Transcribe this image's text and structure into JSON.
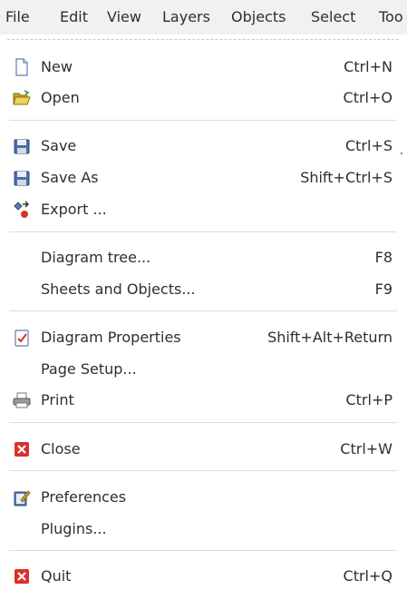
{
  "menubar": {
    "items": [
      "File",
      "Edit",
      "View",
      "Layers",
      "Objects",
      "Select",
      "Too"
    ]
  },
  "file_menu": {
    "new": {
      "label": "New",
      "accel": "Ctrl+N",
      "icon": "new-document-icon"
    },
    "open": {
      "label": "Open",
      "accel": "Ctrl+O",
      "icon": "open-folder-icon"
    },
    "save": {
      "label": "Save",
      "accel": "Ctrl+S",
      "icon": "floppy-disk-icon"
    },
    "save_as": {
      "label": "Save As",
      "accel": "Shift+Ctrl+S",
      "icon": "floppy-disk-icon"
    },
    "export": {
      "label": "Export ...",
      "accel": "",
      "icon": "export-icon"
    },
    "diagram_tree": {
      "label": "Diagram tree...",
      "accel": "F8"
    },
    "sheets_objects": {
      "label": "Sheets and Objects...",
      "accel": "F9"
    },
    "diagram_properties": {
      "label": "Diagram Properties",
      "accel": "Shift+Alt+Return",
      "icon": "properties-checkbox-icon"
    },
    "page_setup": {
      "label": "Page Setup...",
      "accel": ""
    },
    "print": {
      "label": "Print",
      "accel": "Ctrl+P",
      "icon": "printer-icon"
    },
    "close": {
      "label": "Close",
      "accel": "Ctrl+W",
      "icon": "close-icon"
    },
    "preferences": {
      "label": "Preferences",
      "accel": "",
      "icon": "preferences-icon"
    },
    "plugins": {
      "label": "Plugins...",
      "accel": ""
    },
    "quit": {
      "label": "Quit",
      "accel": "Ctrl+Q",
      "icon": "quit-icon"
    }
  },
  "colors": {
    "menubar_bg": "#f2f1f0",
    "text": "#2e2e2e",
    "separator": "#dcdcdc",
    "close_red": "#d9322a",
    "save_blue": "#4a6fa5",
    "folder_yellow": "#e8c341"
  }
}
